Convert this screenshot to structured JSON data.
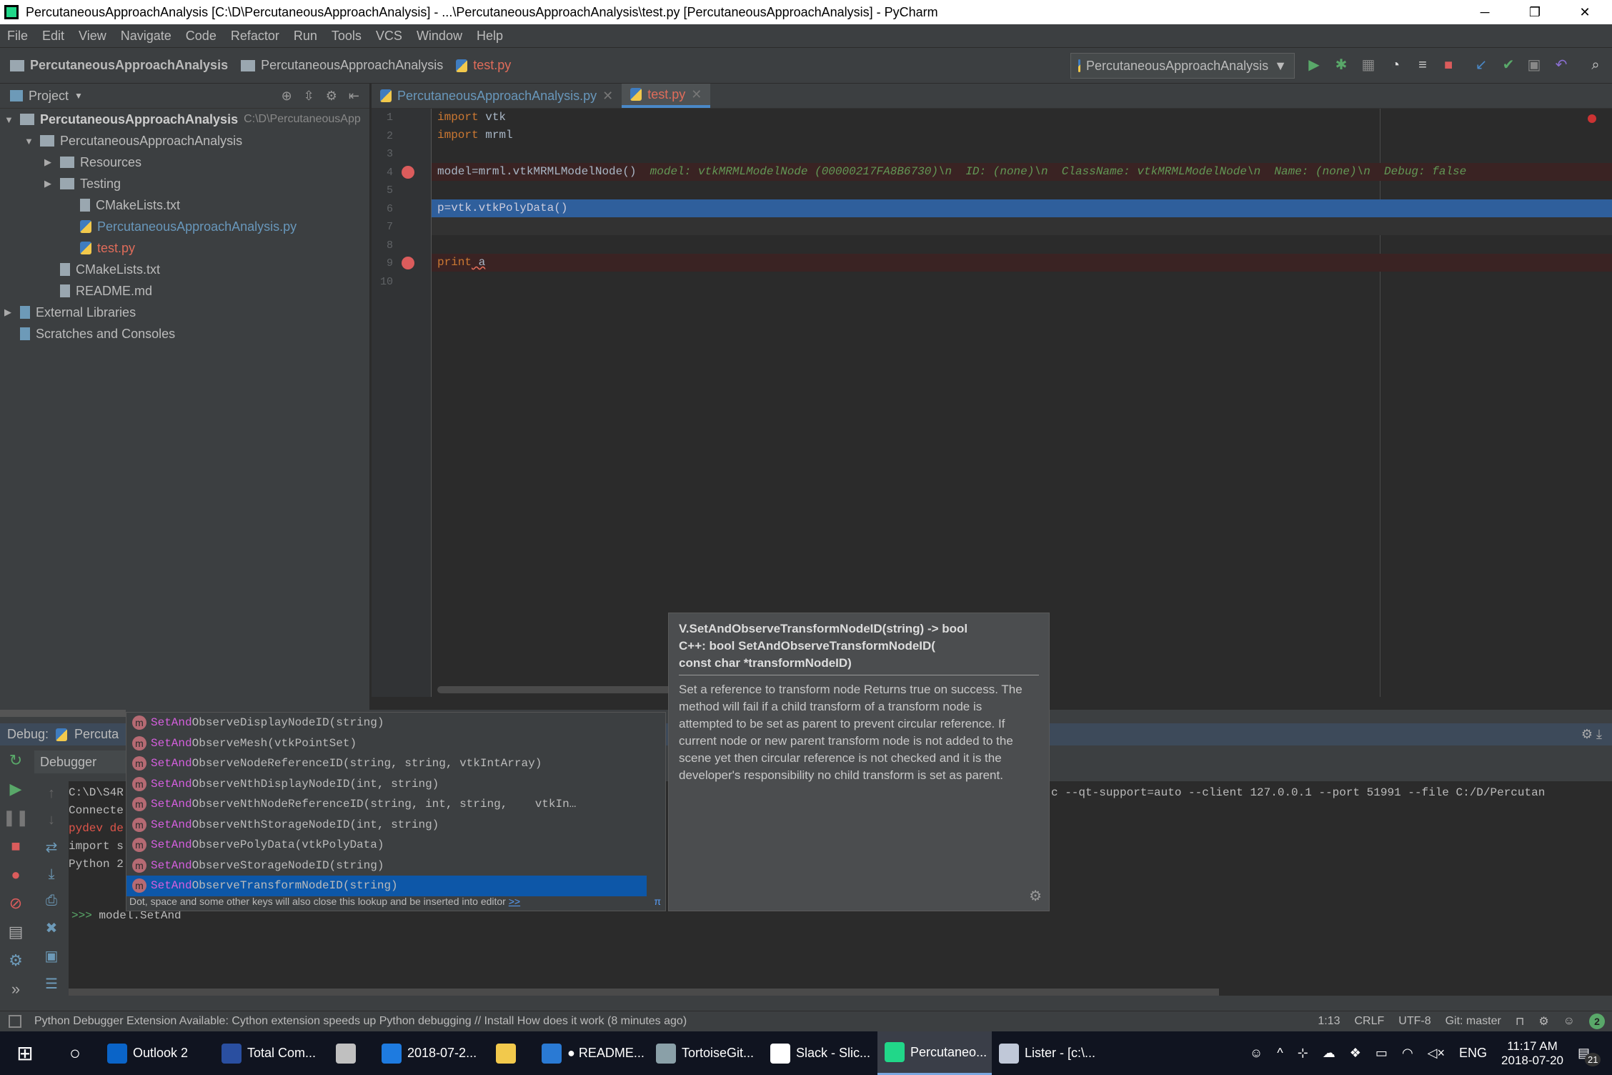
{
  "window": {
    "title": "PercutaneousApproachAnalysis [C:\\D\\PercutaneousApproachAnalysis] - ...\\PercutaneousApproachAnalysis\\test.py [PercutaneousApproachAnalysis] - PyCharm",
    "minimize": "─",
    "restore": "❐",
    "close": "✕"
  },
  "menu": [
    "File",
    "Edit",
    "View",
    "Navigate",
    "Code",
    "Refactor",
    "Run",
    "Tools",
    "VCS",
    "Window",
    "Help"
  ],
  "breadcrumbs": [
    "PercutaneousApproachAnalysis",
    "PercutaneousApproachAnalysis",
    "test.py"
  ],
  "run_config": "PercutaneousApproachAnalysis",
  "project": {
    "header": "Project",
    "root": "PercutaneousApproachAnalysis",
    "root_path": "C:\\D\\PercutaneousApp",
    "items": [
      {
        "label": "PercutaneousApproachAnalysis",
        "indent": 1,
        "type": "folder",
        "expanded": true
      },
      {
        "label": "Resources",
        "indent": 2,
        "type": "folder"
      },
      {
        "label": "Testing",
        "indent": 2,
        "type": "folder"
      },
      {
        "label": "CMakeLists.txt",
        "indent": 3,
        "type": "file"
      },
      {
        "label": "PercutaneousApproachAnalysis.py",
        "indent": 3,
        "type": "py",
        "color": "#6897bb"
      },
      {
        "label": "test.py",
        "indent": 3,
        "type": "py",
        "color": "#e06c5a"
      },
      {
        "label": "CMakeLists.txt",
        "indent": 2,
        "type": "file"
      },
      {
        "label": "README.md",
        "indent": 2,
        "type": "file"
      },
      {
        "label": "External Libraries",
        "indent": 0,
        "type": "lib"
      },
      {
        "label": "Scratches and Consoles",
        "indent": 0,
        "type": "scratch"
      }
    ]
  },
  "tabs": [
    {
      "label": "PercutaneousApproachAnalysis.py",
      "active": false
    },
    {
      "label": "test.py",
      "active": true
    }
  ],
  "editor": {
    "line_numbers": [
      "1",
      "2",
      "3",
      "4",
      "5",
      "6",
      "7",
      "8",
      "9",
      "10"
    ],
    "lines": {
      "l1_kw": "import",
      "l1": " vtk",
      "l2_kw": "import",
      "l2": " mrml",
      "l4": "model=mrml.vtkMRMLModelNode()",
      "l4_hint": "model: vtkMRMLModelNode (00000217FA8B6730)\\n  ID: (none)\\n  ClassName: vtkMRMLModelNode\\n  Name: (none)\\n  Debug: false",
      "l6": "p=vtk.vtkPolyData()",
      "l9_kw": "print",
      "l9": " a"
    }
  },
  "debug": {
    "label": "Debug:",
    "config": "Percuta",
    "tab": "Debugger",
    "console": [
      "C:\\D\\S4R",
      "Connecte",
      "pydev de",
      "",
      "import s",
      "Python 2"
    ],
    "console_cmd": "c --qt-support=auto --client 127.0.0.1 --port 51991 --file C:/D/Percutan",
    "prompt": ">>>",
    "input": "model.SetAnd"
  },
  "completion": {
    "prefix": "SetAnd",
    "items": [
      {
        "rest": "ObserveDisplayNodeID",
        "args": "(string)"
      },
      {
        "rest": "ObserveMesh",
        "args": "(vtkPointSet)"
      },
      {
        "rest": "ObserveNodeReferenceID",
        "args": "(string, string, vtkIntArray)"
      },
      {
        "rest": "ObserveNthDisplayNodeID",
        "args": "(int, string)"
      },
      {
        "rest": "ObserveNthNodeReferenceID",
        "args": "(string, int, string,    vtkIn…"
      },
      {
        "rest": "ObserveNthStorageNodeID",
        "args": "(int, string)"
      },
      {
        "rest": "ObservePolyData",
        "args": "(vtkPolyData)"
      },
      {
        "rest": "ObserveStorageNodeID",
        "args": "(string)"
      },
      {
        "rest": "ObserveTransformNodeID",
        "args": "(string)"
      }
    ],
    "selected_index": 8,
    "footer": "Dot, space and some other keys will also close this lookup and be inserted into editor",
    "footer_link": ">>",
    "pi": "π"
  },
  "docs": {
    "sig1": "V.SetAndObserveTransformNodeID(string) -> bool",
    "sig2": "C++: bool SetAndObserveTransformNodeID(",
    "sig3": "const char *transformNodeID)",
    "body": "Set a reference to transform node Returns true on success. The method will fail if a child transform of a transform node is attempted to be set as parent to prevent circular reference. If current node or new parent transform node is not added to the scene yet then circular reference is not checked and it is the developer's responsibility no child transform is set as parent."
  },
  "status": {
    "message": "Python Debugger Extension Available: Cython extension speeds up Python debugging // Install How does it work (8 minutes ago)",
    "position": "1:13",
    "line_sep": "CRLF",
    "encoding": "UTF-8",
    "vcs": "Git: master",
    "notifications": "2"
  },
  "taskbar": {
    "apps": [
      {
        "label": "Outlook 2",
        "color": "#0a64c8"
      },
      {
        "label": "Total Com...",
        "color": "#2a4fa0"
      },
      {
        "label": "",
        "color": "#c0c0c0"
      },
      {
        "label": "2018-07-2...",
        "color": "#1e7be0"
      },
      {
        "label": "",
        "color": "#f2c94c"
      },
      {
        "label": "● README...",
        "color": "#2a7ad4"
      },
      {
        "label": "TortoiseGit...",
        "color": "#8aa0a8"
      },
      {
        "label": "Slack - Slic...",
        "color": "#ffffff"
      },
      {
        "label": "Percutaneo...",
        "color": "#21d789",
        "active": true
      },
      {
        "label": "Lister - [c:\\...",
        "color": "#c0c8d8"
      }
    ],
    "lang": "ENG",
    "time": "11:17 AM",
    "date": "2018-07-20",
    "notif_count": "21"
  }
}
